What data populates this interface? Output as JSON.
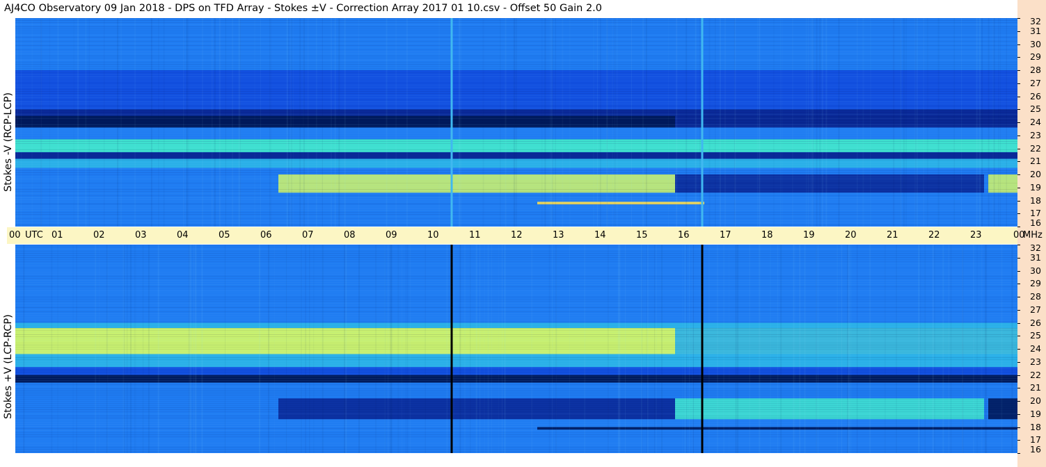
{
  "title": "AJ4CO Observatory  09 Jan 2018  -  DPS on TFD Array  -  Stokes ±V  -  Correction Array 2017 01 10.csv  -  Offset 50  Gain 2.0",
  "colors": {
    "background": "#ffffff",
    "utc_bar": "#fcf6c4",
    "freq_strip": "#fbe0c8",
    "colormap": [
      "#001a5c",
      "#0a2a9a",
      "#1250e0",
      "#1f7cf2",
      "#2ab0e8",
      "#3fe0d0",
      "#c8f070",
      "#ffe050"
    ]
  },
  "chart_data": [
    {
      "type": "heatmap",
      "title": "",
      "ylabel": "Stokes -V (RCP-LCP)",
      "xlabel": "UTC",
      "x_range": [
        "00",
        "00"
      ],
      "x_ticks": [
        "00",
        "01",
        "02",
        "03",
        "04",
        "05",
        "06",
        "07",
        "08",
        "09",
        "10",
        "11",
        "12",
        "13",
        "14",
        "15",
        "16",
        "17",
        "18",
        "19",
        "20",
        "21",
        "22",
        "23",
        "00"
      ],
      "y_unit": "MHz",
      "y_range": [
        16,
        32
      ],
      "y_ticks": [
        "32",
        "31",
        "30",
        "29",
        "28",
        "27",
        "26",
        "25",
        "24",
        "23",
        "22",
        "21",
        "20",
        "19",
        "18",
        "17",
        "16"
      ],
      "bands": [
        {
          "f_lo": 28.0,
          "f_hi": 32.0,
          "level": 3
        },
        {
          "f_lo": 25.0,
          "f_hi": 28.0,
          "level": 2
        },
        {
          "f_lo": 24.5,
          "f_hi": 25.0,
          "level": 1
        },
        {
          "f_lo": 23.6,
          "f_hi": 24.5,
          "level": 0
        },
        {
          "f_lo": 22.7,
          "f_hi": 23.6,
          "level": 3
        },
        {
          "f_lo": 21.7,
          "f_hi": 22.7,
          "level": 5
        },
        {
          "f_lo": 21.2,
          "f_hi": 21.7,
          "level": 1
        },
        {
          "f_lo": 20.5,
          "f_hi": 21.2,
          "level": 4
        },
        {
          "f_lo": 16.0,
          "f_hi": 20.5,
          "level": 3
        }
      ],
      "patches": [
        {
          "t0": 6.3,
          "t1": 15.8,
          "f_lo": 18.6,
          "f_hi": 20.0,
          "level": 6
        },
        {
          "t0": 15.8,
          "t1": 23.2,
          "f_lo": 18.6,
          "f_hi": 20.0,
          "level": 1
        },
        {
          "t0": 23.3,
          "t1": 24.0,
          "f_lo": 18.6,
          "f_hi": 20.0,
          "level": 6
        },
        {
          "t0": 15.8,
          "t1": 24.0,
          "f_lo": 23.6,
          "f_hi": 24.8,
          "level": 1
        },
        {
          "t0": 12.5,
          "t1": 16.5,
          "f_lo": 17.7,
          "f_hi": 17.9,
          "level": 7
        }
      ],
      "vlines": [
        {
          "t": 10.45,
          "color": "#40b8f0"
        },
        {
          "t": 16.45,
          "color": "#40b8f0"
        }
      ]
    },
    {
      "type": "heatmap",
      "title": "",
      "ylabel": "Stokes +V (LCP-RCP)",
      "xlabel": "UTC",
      "x_range": [
        "00",
        "00"
      ],
      "y_unit": "MHz",
      "y_range": [
        16,
        32
      ],
      "y_ticks": [
        "32",
        "31",
        "30",
        "29",
        "28",
        "27",
        "26",
        "25",
        "24",
        "23",
        "22",
        "21",
        "20",
        "19",
        "18",
        "17",
        "16"
      ],
      "bands": [
        {
          "f_lo": 26.0,
          "f_hi": 32.0,
          "level": 3
        },
        {
          "f_lo": 25.6,
          "f_hi": 26.0,
          "level": 4
        },
        {
          "f_lo": 23.6,
          "f_hi": 25.6,
          "level": 6
        },
        {
          "f_lo": 22.6,
          "f_hi": 23.6,
          "level": 4
        },
        {
          "f_lo": 22.0,
          "f_hi": 22.6,
          "level": 2
        },
        {
          "f_lo": 21.4,
          "f_hi": 22.0,
          "level": 0
        },
        {
          "f_lo": 16.0,
          "f_hi": 21.4,
          "level": 3
        }
      ],
      "patches": [
        {
          "t0": 6.3,
          "t1": 15.8,
          "f_lo": 18.6,
          "f_hi": 20.2,
          "level": 1
        },
        {
          "t0": 15.8,
          "t1": 23.2,
          "f_lo": 18.6,
          "f_hi": 20.2,
          "level": 5
        },
        {
          "t0": 23.3,
          "t1": 24.0,
          "f_lo": 18.6,
          "f_hi": 20.2,
          "level": 0
        },
        {
          "t0": 15.8,
          "t1": 24.0,
          "f_lo": 23.6,
          "f_hi": 25.6,
          "level": 4
        },
        {
          "t0": 12.5,
          "t1": 24.0,
          "f_lo": 17.8,
          "f_hi": 18.0,
          "level": 0
        }
      ],
      "vlines": [
        {
          "t": 10.45,
          "color": "#000000"
        },
        {
          "t": 16.45,
          "color": "#000000"
        }
      ]
    }
  ],
  "utc_axis": {
    "labels": [
      "00",
      "UTC",
      "01",
      "02",
      "03",
      "04",
      "05",
      "06",
      "07",
      "08",
      "09",
      "10",
      "11",
      "12",
      "13",
      "14",
      "15",
      "16",
      "17",
      "18",
      "19",
      "20",
      "21",
      "22",
      "23",
      "00",
      "MHz"
    ]
  }
}
